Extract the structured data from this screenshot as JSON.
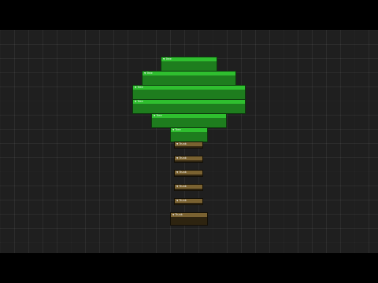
{
  "canvas": {
    "nodes": [
      {
        "label": "Tree",
        "kind": "leaf",
        "collapse_icon": "chevron-down-icon"
      },
      {
        "label": "Tree",
        "kind": "leaf",
        "collapse_icon": "chevron-down-icon"
      },
      {
        "label": "Tree",
        "kind": "leaf",
        "collapse_icon": "chevron-down-icon"
      },
      {
        "label": "Tree",
        "kind": "leaf",
        "collapse_icon": "chevron-down-icon"
      },
      {
        "label": "Tree",
        "kind": "leaf",
        "collapse_icon": "chevron-down-icon"
      },
      {
        "label": "Tree",
        "kind": "leaf",
        "collapse_icon": "chevron-down-icon"
      },
      {
        "label": "Trunk",
        "kind": "trunk",
        "collapse_icon": "chevron-down-icon"
      },
      {
        "label": "Trunk",
        "kind": "trunk",
        "collapse_icon": "chevron-down-icon"
      },
      {
        "label": "Trunk",
        "kind": "trunk",
        "collapse_icon": "chevron-down-icon"
      },
      {
        "label": "Trunk",
        "kind": "trunk",
        "collapse_icon": "chevron-down-icon"
      },
      {
        "label": "Trunk",
        "kind": "trunk",
        "collapse_icon": "chevron-down-icon"
      },
      {
        "label": "Trunk",
        "kind": "trunk",
        "collapse_icon": "chevron-down-icon"
      }
    ]
  },
  "colors": {
    "canvas_background": "#1f1f1f",
    "leaf_header": "#2fbf2f",
    "leaf_body": "#1e7d1e",
    "trunk_header": "#7a6231",
    "trunk_body": "#2e2410"
  }
}
